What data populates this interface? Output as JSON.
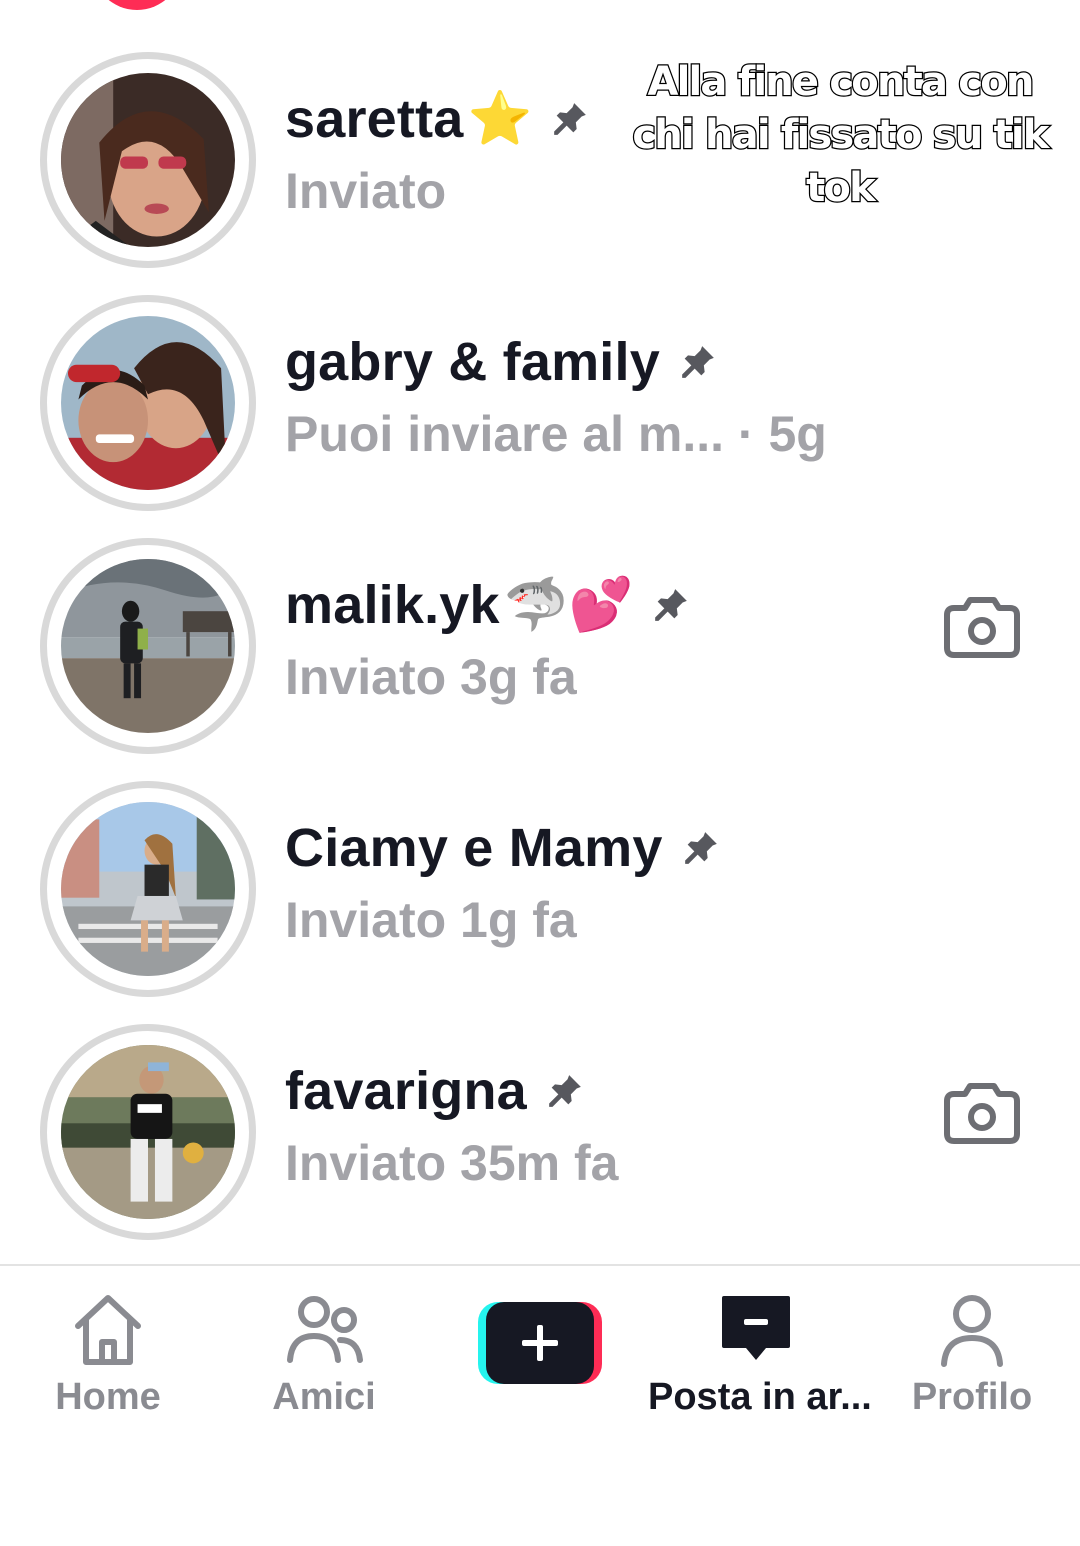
{
  "overlay": {
    "caption": "Alla fine conta con chi hai fissato su tik tok"
  },
  "chats": [
    {
      "name": "saretta",
      "emoji": "⭐",
      "status": "Inviato",
      "pinned": true,
      "camera": false
    },
    {
      "name": "gabry & family",
      "emoji": "",
      "status": "Puoi inviare al m... · 5g",
      "pinned": true,
      "camera": false
    },
    {
      "name": "malik.yk",
      "emoji": "🦈💕",
      "status": "Inviato 3g fa",
      "pinned": true,
      "camera": true
    },
    {
      "name": "Ciamy e Mamy",
      "emoji": "",
      "status": "Inviato 1g fa",
      "pinned": true,
      "camera": false
    },
    {
      "name": "favarigna",
      "emoji": "",
      "status": "Inviato 35m fa",
      "pinned": true,
      "camera": true
    }
  ],
  "nav": {
    "home": "Home",
    "friends": "Amici",
    "inbox": "Posta in ar...",
    "profile": "Profilo",
    "active": "inbox"
  },
  "colors": {
    "name_text": "#161823",
    "sub_text": "#a3a3a8",
    "ring": "#d9d9d9",
    "accent_pink": "#fe2c55",
    "accent_cyan": "#25f4ee",
    "nav_inactive": "#8a8b91"
  },
  "icons": {
    "pin": "pin-icon",
    "camera": "camera-icon",
    "home": "home-icon",
    "friends": "friends-icon",
    "create": "plus-icon",
    "inbox": "inbox-icon",
    "profile": "profile-icon"
  }
}
